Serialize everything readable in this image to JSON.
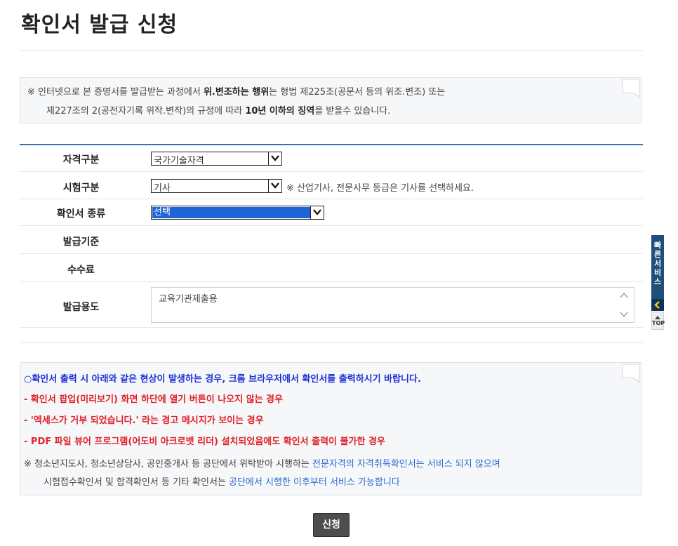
{
  "page": {
    "title": "확인서 발급 신청"
  },
  "notice": {
    "p1": "※ 인터넷으로 본 증명서를 발급받는 과정에서 ",
    "b1": "위.변조하는 행위",
    "p2": "는 형법 제225조(공문서 등의 위조.변조) 또는",
    "p3": "제227조의 2(공전자기록 위작.변작)의 규정에 따라 ",
    "b2": "10년 이하의 징역",
    "p4": "을 받을수 있습니다."
  },
  "form": {
    "license_type": {
      "label": "자격구분",
      "value": "국가기술자격"
    },
    "exam_type": {
      "label": "시험구분",
      "value": "기사",
      "hint": "※ 산업기사, 전문사무 등급은 기사를 선택하세요."
    },
    "cert_type": {
      "label": "확인서 종류",
      "value": "선택"
    },
    "issue_basis": {
      "label": "발급기준",
      "value": ""
    },
    "fee": {
      "label": "수수료",
      "value": ""
    },
    "purpose": {
      "label": "발급용도",
      "value": "교육기관제출용"
    }
  },
  "warnings": {
    "title": "○확인서 출력 시 아래와 같은 현상이 발생하는 경우, 크롬 브라우저에서 확인서를 출력하시기 바랍니다.",
    "items": [
      "- 확인서 팝업(미리보기) 화면 하단에 열기 버튼이 나오지 않는 경우",
      "- '엑세스가 거부 되었습니다.' 라는 경고 메시지가 보이는 경우",
      "- PDF 파일 뷰어 프로그램(어도비 아크로벳 리더) 설치되었음에도 확인서 출력이 불가한 경우"
    ],
    "note_a1": "※ 청소년지도사, 청소년상담사, 공인중개사 등 공단에서 위탁받아 시행하는 ",
    "note_a2": "전문자격의 자격취득확인서는 서비스 되지 않으며",
    "note_b1": "시험접수확인서 및 합격확인서 등 기타 확인서는 ",
    "note_b2": "공단에서 시행한 이후부터 서비스 가능합니다"
  },
  "submit_label": "신청",
  "side": {
    "quick_label": "빠른서비스",
    "top_label": "TOP"
  },
  "colors": {
    "accent": "#3a6fb0",
    "warning_red": "#e0222a",
    "title_blue": "#1a2fd6",
    "quick_bg": "#1f4f7a"
  }
}
